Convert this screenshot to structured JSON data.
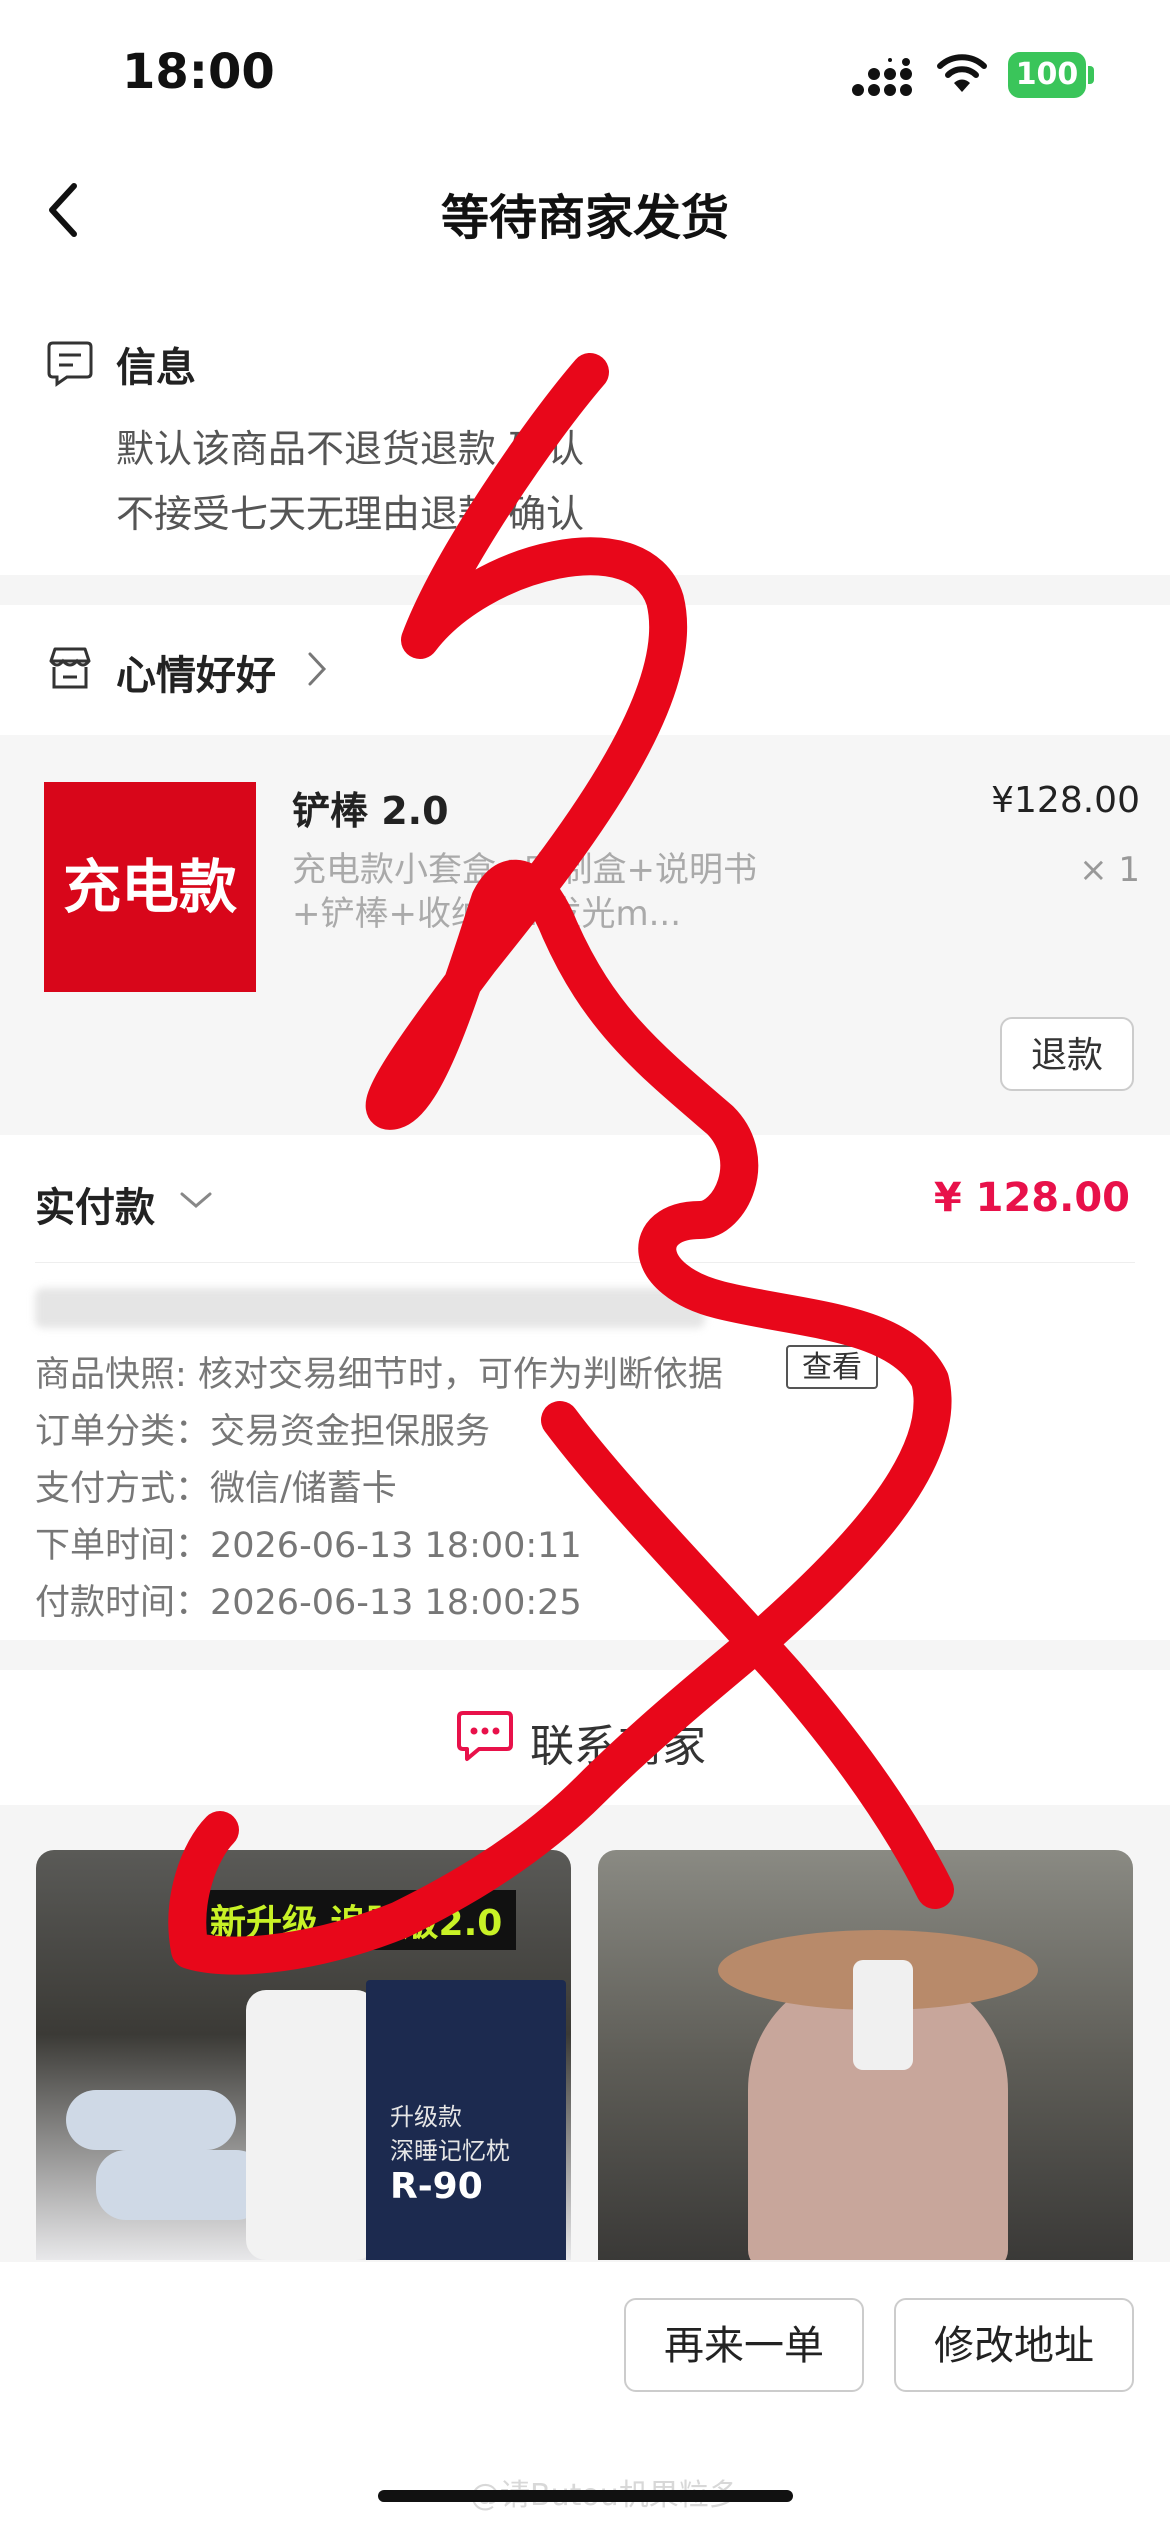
{
  "status_bar": {
    "time": "18:00",
    "battery": "100"
  },
  "nav": {
    "title": "等待商家发货"
  },
  "info": {
    "title": "信息",
    "line1": "默认该商品不退货退款 确认",
    "line2": "不接受七天无理由退款 确认"
  },
  "shop": {
    "name": "心情好好"
  },
  "product": {
    "thumb_text": "充电款",
    "name": "铲棒 2.0",
    "price": "¥128.00",
    "desc": "充电款小套盒+定制盒+说明书+铲棒+收纳袋+发光m...",
    "qty": "× 1",
    "refund_label": "退款"
  },
  "payment": {
    "label": "实付款",
    "amount": "¥ 128.00",
    "snapshot": "商品快照: 核对交易细节时，可作为判断依据",
    "view_label": "查看",
    "order_type": "订单分类：交易资金担保服务",
    "pay_method": "支付方式：微信/储蓄卡",
    "order_time": "下单时间：2026-06-13 18:00:11",
    "paid_time": "付款时间：2026-06-13 18:00:25"
  },
  "contact": {
    "label": "联系商家"
  },
  "recommend": {
    "card1_banner": "新升级 追踪版2.0",
    "card1_box_text1": "升级款",
    "card1_box_text2": "深睡记忆枕",
    "card1_box_model": "R-90"
  },
  "bottom": {
    "reorder_label": "再来一单",
    "address_label": "修改地址"
  },
  "watermark": "@请Butou机果粒多",
  "colors": {
    "accent_price": "#e8114a",
    "thumb_red": "#d8061a",
    "battery_green": "#3ac55a",
    "scribble_red": "#e8071a"
  },
  "icons": [
    "signal-icon",
    "wifi-icon",
    "back-chevron-icon",
    "info-message-icon",
    "shop-icon",
    "chevron-right-icon",
    "chevron-down-icon",
    "chat-icon"
  ]
}
